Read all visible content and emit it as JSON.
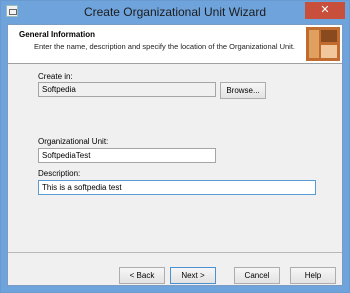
{
  "window": {
    "title": "Create Organizational Unit Wizard",
    "close_glyph": "✕"
  },
  "header": {
    "title": "General Information",
    "subtitle": "Enter the name, description and specify the location of the Organizational Unit."
  },
  "form": {
    "create_in_label": "Create in:",
    "create_in_value": "Softpedia",
    "browse_label": "Browse...",
    "ou_label": "Organizational Unit:",
    "ou_value": "SoftpediaTest",
    "description_label": "Description:",
    "description_value": "This is a softpedia test"
  },
  "footer": {
    "back_label": "< Back",
    "next_label": "Next >",
    "cancel_label": "Cancel",
    "help_label": "Help"
  }
}
